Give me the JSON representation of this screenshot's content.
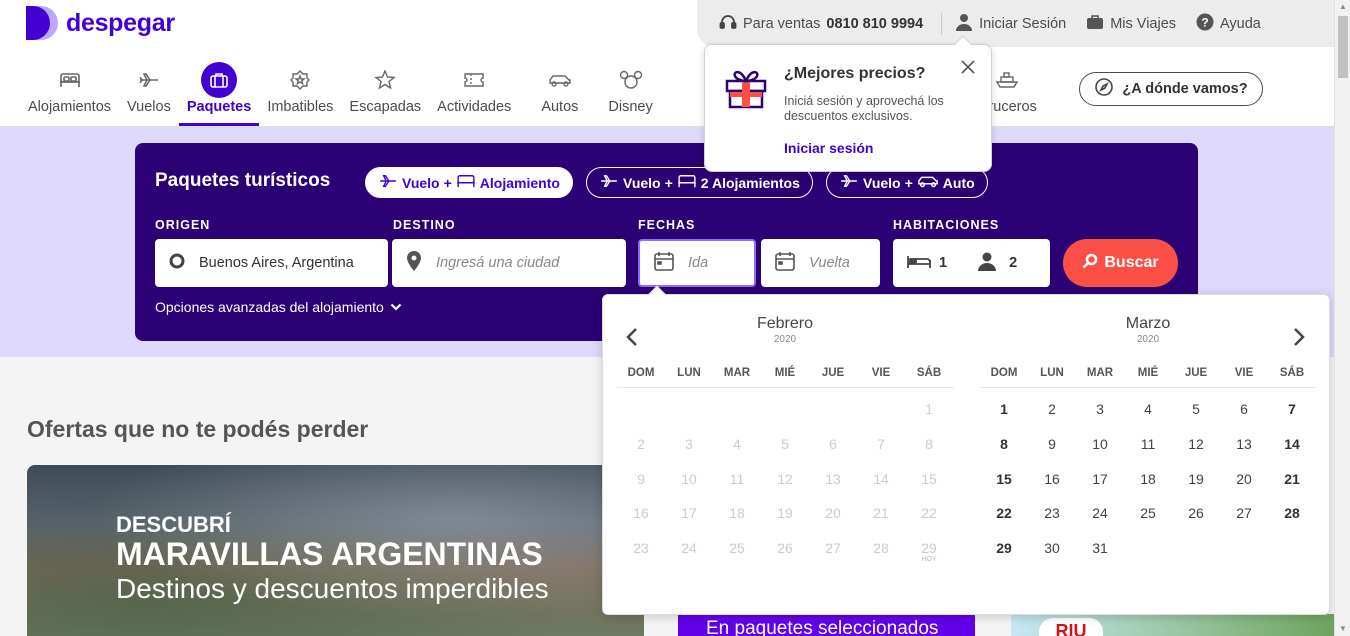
{
  "brand": {
    "name": "despegar"
  },
  "topbar": {
    "sales_label": "Para ventas",
    "sales_phone": "0810 810 9994",
    "login": "Iniciar Sesión",
    "trips": "Mis Viajes",
    "help": "Ayuda"
  },
  "nav": [
    {
      "label": "Alojamientos",
      "icon": "bed-icon"
    },
    {
      "label": "Vuelos",
      "icon": "plane-icon"
    },
    {
      "label": "Paquetes",
      "icon": "suitcase-icon"
    },
    {
      "label": "Imbatibles",
      "icon": "badge-icon"
    },
    {
      "label": "Escapadas",
      "icon": "star-icon"
    },
    {
      "label": "Actividades",
      "icon": "ticket-icon"
    },
    {
      "label": "Autos",
      "icon": "car-icon"
    },
    {
      "label": "Disney",
      "icon": "mickey-icon"
    },
    {
      "label": "Cruceros",
      "icon": "ship-icon"
    }
  ],
  "where_button": "¿A dónde vamos?",
  "popover": {
    "title": "¿Mejores precios?",
    "body": "Iniciá sesión y aprovechá los descuentos exclusivos.",
    "link": "Iniciar sesión"
  },
  "search": {
    "title": "Paquetes turísticos",
    "chips": [
      {
        "pre": "Vuelo",
        "plus": "+",
        "label": "Alojamiento"
      },
      {
        "pre": "Vuelo",
        "plus": "+",
        "label": "2 Alojamientos"
      },
      {
        "pre": "Vuelo",
        "plus": "+",
        "label": "Auto"
      }
    ],
    "origin_label": "ORIGEN",
    "origin_value": "Buenos Aires, Argentina",
    "dest_label": "DESTINO",
    "dest_placeholder": "Ingresá una ciudad",
    "dates_label": "FECHAS",
    "ida_placeholder": "Ida",
    "vuelta_placeholder": "Vuelta",
    "rooms_label": "HABITACIONES",
    "rooms": "1",
    "people": "2",
    "button": "Buscar",
    "advanced": "Opciones avanzadas del alojamiento"
  },
  "offers": {
    "title": "Ofertas que no te podés perder",
    "promo_line1": "DESCUBRÍ",
    "promo_line2": "MARAVILLAS ARGENTINAS",
    "promo_line3": "Destinos y descuentos imperdibles",
    "promo2_text": "En paquetes seleccionados",
    "promo3_brand": "RIU"
  },
  "calendar": {
    "weekdays": [
      "DOM",
      "LUN",
      "MAR",
      "MIÉ",
      "JUE",
      "VIE",
      "SÁB"
    ],
    "months": [
      {
        "name": "Febrero",
        "year": "2020",
        "days": [
          "",
          "",
          "",
          "",
          "",
          "",
          "1",
          "2",
          "3",
          "4",
          "5",
          "6",
          "7",
          "8",
          "9",
          "10",
          "11",
          "12",
          "13",
          "14",
          "15",
          "16",
          "17",
          "18",
          "19",
          "20",
          "21",
          "22",
          "23",
          "24",
          "25",
          "26",
          "27",
          "28",
          "29"
        ],
        "today_label": "HOY"
      },
      {
        "name": "Marzo",
        "year": "2020",
        "days": [
          "1",
          "2",
          "3",
          "4",
          "5",
          "6",
          "7",
          "8",
          "9",
          "10",
          "11",
          "12",
          "13",
          "14",
          "15",
          "16",
          "17",
          "18",
          "19",
          "20",
          "21",
          "22",
          "23",
          "24",
          "25",
          "26",
          "27",
          "28",
          "29",
          "30",
          "31"
        ]
      }
    ]
  },
  "colors": {
    "brand": "#4300d2",
    "search_bg": "#2b0074",
    "band": "#ded8fb",
    "cta": "#fc5047"
  }
}
